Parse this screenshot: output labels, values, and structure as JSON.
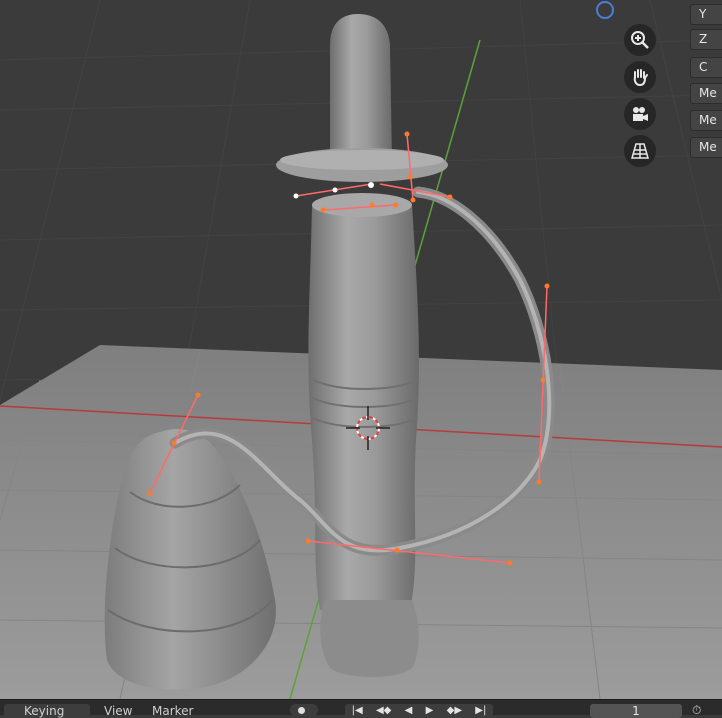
{
  "viewport": {
    "gizmo": {
      "zoom_icon": "zoom-in-icon",
      "pan_icon": "hand-icon",
      "camera_icon": "camera-icon",
      "perspective_icon": "grid-perspective-icon"
    },
    "side_buttons": [
      {
        "label": "Y"
      },
      {
        "label": "Z"
      },
      {
        "label": "C"
      },
      {
        "label": "Me"
      },
      {
        "label": "Me"
      },
      {
        "label": "Me"
      }
    ],
    "colors": {
      "background": "#3b3b3b",
      "floor": "#8f8f8f",
      "mesh": "#9a9a9a",
      "curve_handle": "#ff7a2a",
      "axis_x": "#b83a3a",
      "axis_y": "#5ca23a"
    }
  },
  "timeline": {
    "keying_label": "Keying",
    "view_label": "View",
    "marker_label": "Marker",
    "current_frame": "1",
    "controls": [
      "|◀",
      "◀◆",
      "◀",
      "▶",
      "◆▶",
      "▶|"
    ]
  }
}
